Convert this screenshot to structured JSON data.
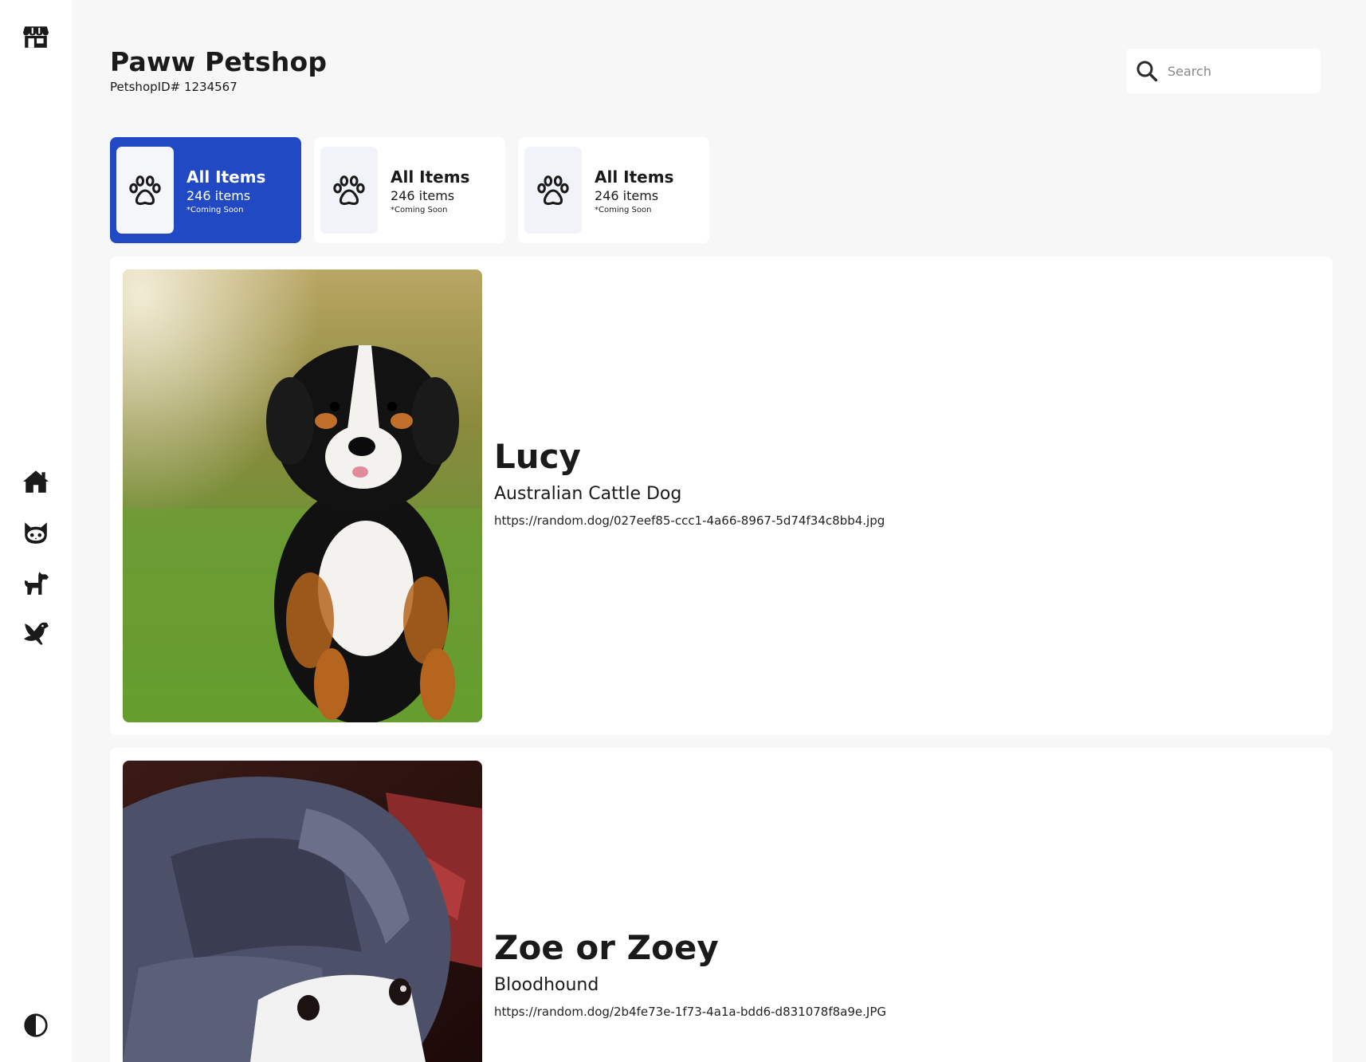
{
  "shop": {
    "title": "Paww Petshop",
    "id_label": "PetshopID# 1234567"
  },
  "search": {
    "placeholder": "Search"
  },
  "sidebar": {
    "top_icon": "store-icon",
    "nav": [
      "home-icon",
      "cat-icon",
      "dog-icon",
      "bird-icon"
    ],
    "bottom_icon": "contrast-icon"
  },
  "categories": [
    {
      "name": "All Items",
      "count": "246 items",
      "note": "*Coming Soon",
      "icon": "paw-icon",
      "active": true
    },
    {
      "name": "All Items",
      "count": "246 items",
      "note": "*Coming Soon",
      "icon": "paw-icon",
      "active": false
    },
    {
      "name": "All Items",
      "count": "246 items",
      "note": "*Coming Soon",
      "icon": "paw-icon",
      "active": false
    }
  ],
  "pets": [
    {
      "name": "Lucy",
      "breed": "Australian Cattle Dog",
      "url": "https://random.dog/027eef85-ccc1-4a66-8967-5d74f34c8bb4.jpg"
    },
    {
      "name": "Zoe or Zoey",
      "breed": "Bloodhound",
      "url": "https://random.dog/2b4fe73e-1f73-4a1a-bdd6-d831078f8a9e.JPG"
    }
  ],
  "colors": {
    "accent": "#2149c4",
    "background": "#f7f7f7",
    "surface": "#ffffff"
  }
}
